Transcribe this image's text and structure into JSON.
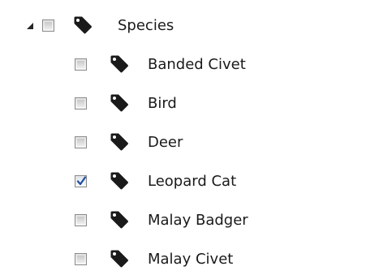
{
  "tree": {
    "root": {
      "label": "Species",
      "expanded": true,
      "checked": false,
      "icon": "tag-icon",
      "expander_icon": "expanded-triangle-icon"
    },
    "children": [
      {
        "label": "Banded Civet",
        "checked": false,
        "icon": "tag-icon"
      },
      {
        "label": "Bird",
        "checked": false,
        "icon": "tag-icon"
      },
      {
        "label": "Deer",
        "checked": false,
        "icon": "tag-icon"
      },
      {
        "label": "Leopard Cat",
        "checked": true,
        "icon": "tag-icon"
      },
      {
        "label": "Malay Badger",
        "checked": false,
        "icon": "tag-icon"
      },
      {
        "label": "Malay Civet",
        "checked": false,
        "icon": "tag-icon"
      }
    ],
    "colors": {
      "text": "#1a1a1a",
      "icon": "#1a1a1a",
      "checkbox_border": "#8a8a8a",
      "checkmark": "#1f4f9e"
    }
  }
}
